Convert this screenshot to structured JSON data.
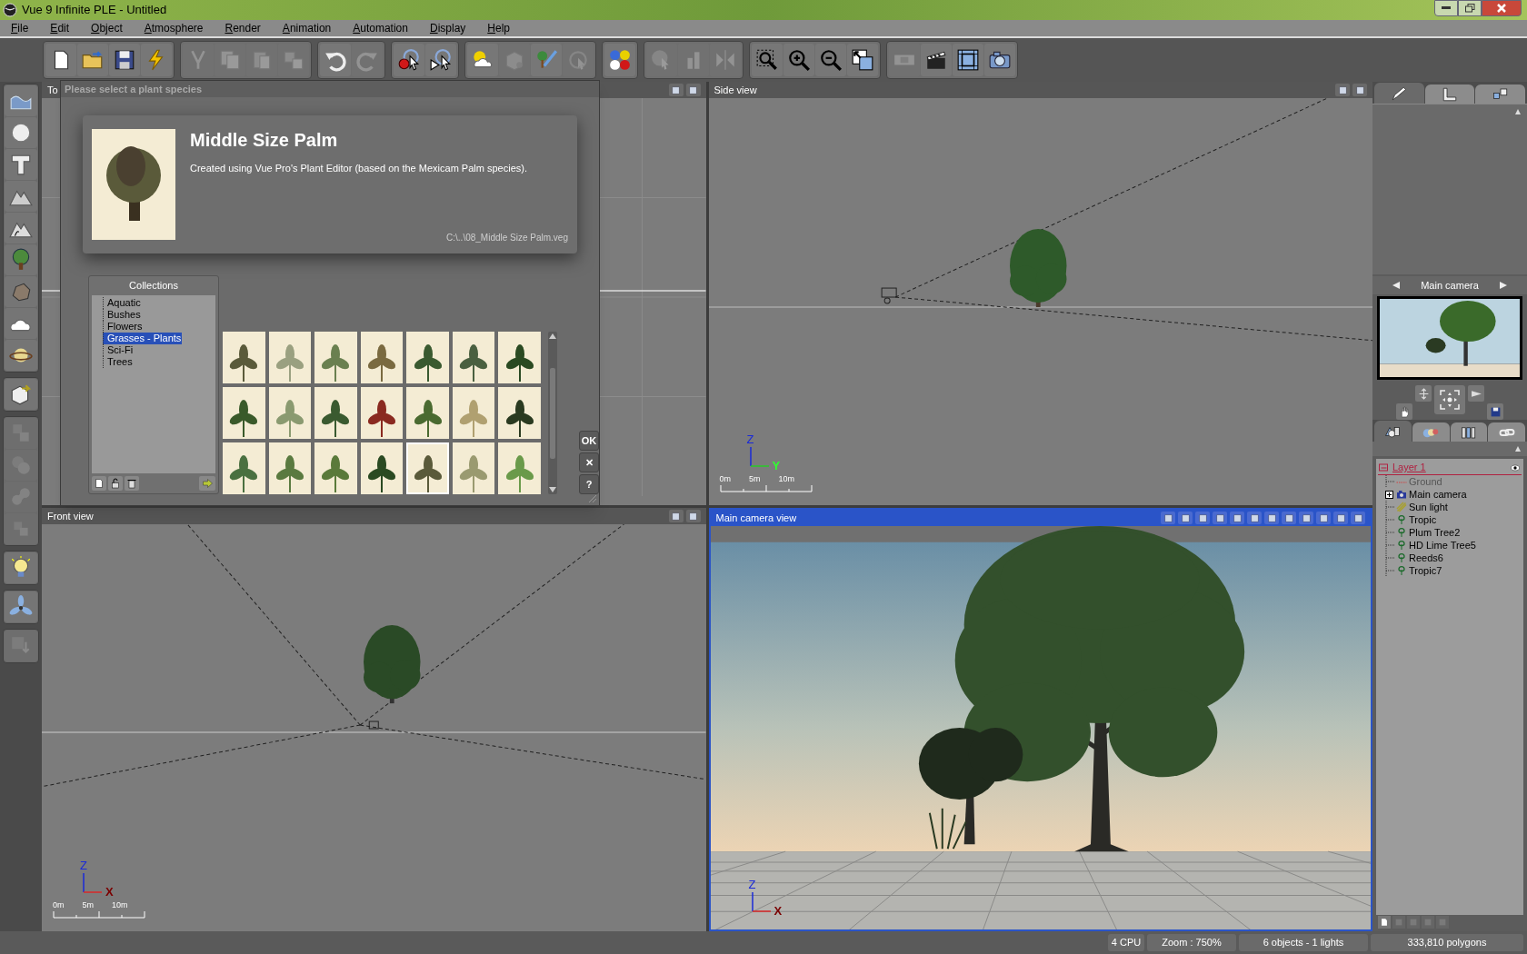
{
  "window": {
    "title": "Vue 9 Infinite PLE - Untitled"
  },
  "menu": [
    "File",
    "Edit",
    "Object",
    "Atmosphere",
    "Render",
    "Animation",
    "Automation",
    "Display",
    "Help"
  ],
  "toolbar": {
    "groups": [
      {
        "buttons": [
          {
            "disabled": false
          },
          {
            "disabled": false
          },
          {
            "disabled": false
          },
          {
            "disabled": false
          }
        ]
      },
      {
        "buttons": [
          {
            "disabled": true
          },
          {
            "disabled": true
          },
          {
            "disabled": true
          },
          {
            "disabled": true
          }
        ]
      },
      {
        "buttons": [
          {
            "disabled": false
          },
          {
            "disabled": true
          }
        ]
      },
      {
        "buttons": [
          {
            "disabled": false
          },
          {
            "disabled": false
          }
        ]
      },
      {
        "buttons": [
          {
            "disabled": false
          },
          {
            "disabled": true
          },
          {
            "disabled": false
          },
          {
            "disabled": true
          }
        ]
      },
      {
        "buttons": [
          {
            "disabled": false
          }
        ]
      },
      {
        "buttons": [
          {
            "disabled": true
          },
          {
            "disabled": true
          },
          {
            "disabled": true
          }
        ]
      },
      {
        "buttons": [
          {
            "disabled": false
          },
          {
            "disabled": false
          },
          {
            "disabled": false
          },
          {
            "disabled": false
          }
        ]
      },
      {
        "buttons": [
          {
            "disabled": true
          },
          {
            "disabled": false
          },
          {
            "disabled": false
          },
          {
            "disabled": false
          }
        ]
      }
    ]
  },
  "left_toolbar": {
    "groups": [
      {
        "buttons": [
          {
            "disabled": false
          },
          {
            "disabled": false
          },
          {
            "disabled": false
          },
          {
            "disabled": false
          },
          {
            "disabled": false
          },
          {
            "disabled": false
          },
          {
            "disabled": false
          },
          {
            "disabled": false
          },
          {
            "disabled": false
          }
        ]
      },
      {
        "buttons": [
          {
            "disabled": false
          }
        ]
      },
      {
        "buttons": [
          {
            "disabled": true
          },
          {
            "disabled": true
          },
          {
            "disabled": true
          },
          {
            "disabled": true
          }
        ]
      },
      {
        "buttons": [
          {
            "disabled": false
          }
        ]
      },
      {
        "buttons": [
          {
            "disabled": false
          }
        ]
      },
      {
        "buttons": [
          {
            "disabled": true
          }
        ]
      }
    ]
  },
  "viewports": [
    {
      "kind": "top",
      "title": "To",
      "active": false
    },
    {
      "kind": "side",
      "title": "Side view",
      "active": false,
      "axes": [
        "Z",
        "Y"
      ],
      "scale": [
        "0m",
        "5m",
        "10m"
      ]
    },
    {
      "kind": "front",
      "title": "Front view",
      "active": false,
      "axes": [
        "Z",
        "X"
      ],
      "scale": [
        "0m",
        "5m",
        "10m"
      ]
    },
    {
      "kind": "camera",
      "title": "Main camera view",
      "active": true,
      "axes": [
        "Z",
        "X"
      ]
    }
  ],
  "dialog": {
    "title": "Please select a plant species",
    "plant": {
      "name": "Middle Size Palm",
      "description": "Created using Vue Pro's Plant Editor (based on the Mexicam Palm species).",
      "path": "C:\\..\\08_Middle Size Palm.veg"
    },
    "collections": {
      "title": "Collections",
      "items": [
        {
          "label": "Aquatic",
          "selected": false
        },
        {
          "label": "Bushes",
          "selected": false
        },
        {
          "label": "Flowers",
          "selected": false
        },
        {
          "label": "Grasses - Plants",
          "selected": true
        },
        {
          "label": "Sci-Fi",
          "selected": false
        },
        {
          "label": "Trees",
          "selected": false
        }
      ]
    },
    "thumbnails": [
      {
        "selected": false
      },
      {
        "selected": false
      },
      {
        "selected": false
      },
      {
        "selected": false
      },
      {
        "selected": false
      },
      {
        "selected": false
      },
      {
        "selected": false
      },
      {
        "selected": false
      },
      {
        "selected": false
      },
      {
        "selected": false
      },
      {
        "selected": false
      },
      {
        "selected": false
      },
      {
        "selected": false
      },
      {
        "selected": false
      },
      {
        "selected": false
      },
      {
        "selected": false
      },
      {
        "selected": false
      },
      {
        "selected": false
      },
      {
        "selected": true
      },
      {
        "selected": false
      },
      {
        "selected": false
      }
    ],
    "buttons": [
      "OK",
      "✕",
      "?"
    ]
  },
  "right_panel": {
    "tabs": [
      {
        "selected": true
      },
      {
        "selected": false
      },
      {
        "selected": false
      }
    ],
    "camera": {
      "label": "Main camera"
    },
    "object_tabs": [
      {
        "selected": true
      },
      {
        "selected": false
      },
      {
        "selected": false
      },
      {
        "selected": false
      }
    ],
    "layers": [
      {
        "label": "Layer 1",
        "children": [
          {
            "label": "Ground",
            "kind": "ground",
            "disabled": true
          },
          {
            "label": "Main camera",
            "kind": "camera",
            "disabled": false,
            "expanded": false
          },
          {
            "label": "Sun light",
            "kind": "light",
            "disabled": false
          },
          {
            "label": "Tropic",
            "kind": "plant",
            "disabled": false
          },
          {
            "label": "Plum Tree2",
            "kind": "plant",
            "disabled": false
          },
          {
            "label": "HD Lime Tree5",
            "kind": "plant",
            "disabled": false
          },
          {
            "label": "Reeds6",
            "kind": "plant",
            "disabled": false
          },
          {
            "label": "Tropic7",
            "kind": "plant",
            "disabled": false
          }
        ]
      }
    ]
  },
  "status_bar": [
    "4 CPU",
    "Zoom : 750%",
    "6 objects - 1 lights",
    "333,810 polygons"
  ]
}
